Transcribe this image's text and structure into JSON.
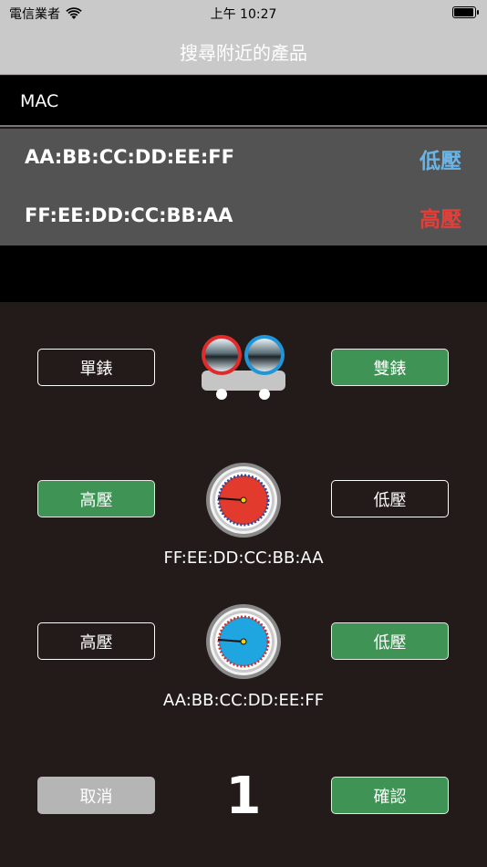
{
  "status_bar": {
    "carrier": "電信業者",
    "time": "上午 10:27",
    "battery_level": 0.95
  },
  "nav": {
    "title": "搜尋附近的產品"
  },
  "list_header": {
    "label": "MAC"
  },
  "devices": [
    {
      "mac": "AA:BB:CC:DD:EE:FF",
      "pressure_label": "低壓",
      "color": "#6ab4e6"
    },
    {
      "mac": "FF:EE:DD:CC:BB:AA",
      "pressure_label": "高壓",
      "color": "#e0403a"
    }
  ],
  "meter_mode": {
    "single_label": "單錶",
    "dual_label": "雙錶",
    "selected": "dual"
  },
  "gauge_high": {
    "high_label": "高壓",
    "low_label": "低壓",
    "selected": "high",
    "mac": "FF:EE:DD:CC:BB:AA",
    "dial_color": "#e23a2c"
  },
  "gauge_low": {
    "high_label": "高壓",
    "low_label": "低壓",
    "selected": "low",
    "mac": "AA:BB:CC:DD:EE:FF",
    "dial_color": "#1fa5e0"
  },
  "footer": {
    "cancel_label": "取消",
    "confirm_label": "確認",
    "count": "1"
  },
  "colors": {
    "green": "#3f9355",
    "panel_bg": "#231b19",
    "list_bg": "#535353",
    "nav_bg": "#c9c9c9"
  }
}
